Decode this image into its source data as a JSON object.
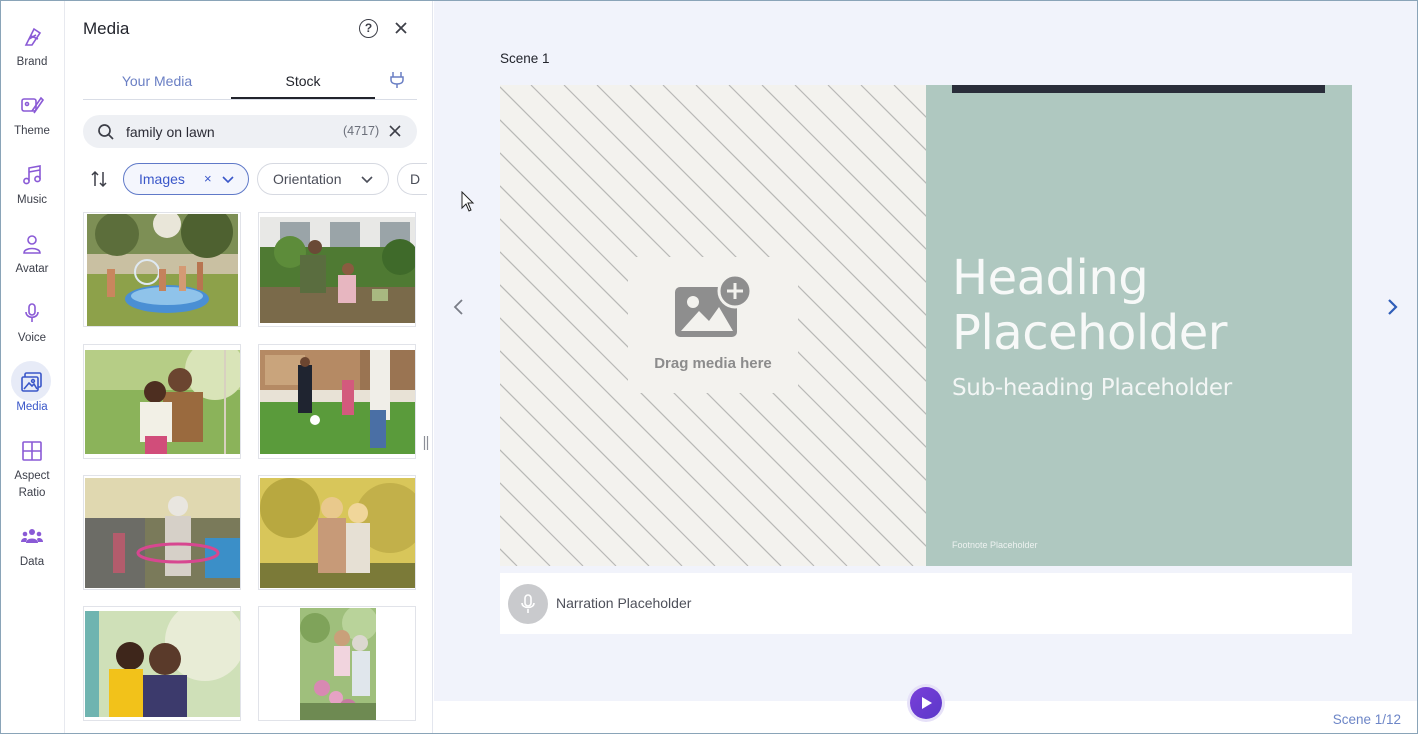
{
  "rail": {
    "items": [
      {
        "label": "Brand",
        "icon": "brand-icon"
      },
      {
        "label": "Theme",
        "icon": "theme-icon"
      },
      {
        "label": "Music",
        "icon": "music-icon"
      },
      {
        "label": "Avatar",
        "icon": "avatar-icon"
      },
      {
        "label": "Voice",
        "icon": "microphone-icon"
      },
      {
        "label": "Media",
        "icon": "media-icon",
        "active": true
      },
      {
        "label": "Aspect Ratio",
        "icon": "aspect-ratio-icon"
      },
      {
        "label": "Data",
        "icon": "data-icon"
      }
    ],
    "accent": "#3a57c9",
    "icon_color": "#8a5ad6"
  },
  "panel": {
    "title": "Media",
    "help_icon": "help-icon",
    "close_icon": "close-icon",
    "tabs": [
      {
        "label": "Your Media",
        "active": false
      },
      {
        "label": "Stock",
        "active": true
      }
    ],
    "plugin_icon": "plug-icon",
    "search": {
      "value": "family on lawn",
      "count": "(4717)"
    },
    "filters": {
      "images_label": "Images",
      "images_clear": "×",
      "orientation_label": "Orientation",
      "more_label": "D"
    },
    "results_count": 8
  },
  "canvas": {
    "scene_label": "Scene 1",
    "drop_text": "Drag media here",
    "heading": "Heading Placeholder",
    "heading_line1": "Heading",
    "heading_line2": "Placeholder",
    "subheading": "Sub-heading Placeholder",
    "footnote": "Footnote Placeholder",
    "narration": "Narration Placeholder",
    "accent_panel_color": "#afc8c0"
  },
  "footer": {
    "scene_counter": "Scene 1/12"
  }
}
